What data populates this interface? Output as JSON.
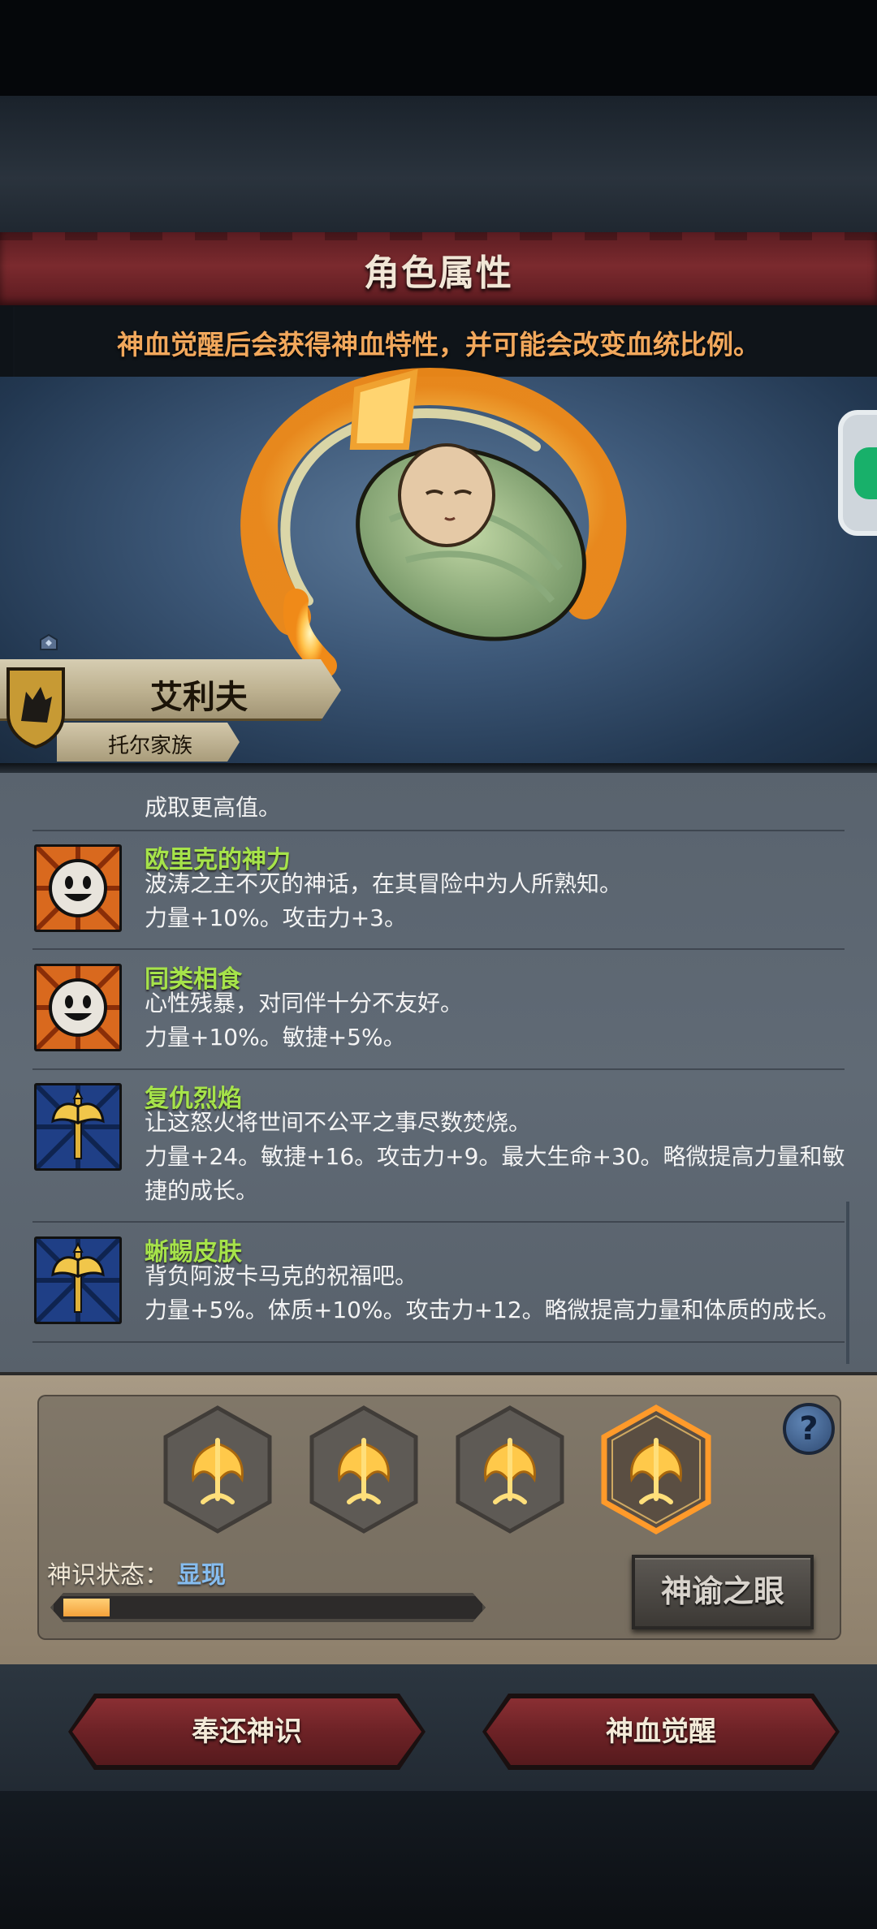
{
  "header": {
    "title": "角色属性",
    "hint": "神血觉醒后会获得神血特性，并可能会改变血统比例。"
  },
  "character": {
    "name": "艾利夫",
    "family": "托尔家族"
  },
  "traits": {
    "cut_off_text": "成取更高值。",
    "items": [
      {
        "name": "欧里克的神力",
        "desc": "波涛之主不灭的神话，在其冒险中为人所熟知。",
        "effect": "力量+10%。攻击力+3。",
        "effect2": "",
        "icon": "smiley-face-icon"
      },
      {
        "name": "同类相食",
        "desc": "心性残暴，对同伴十分不友好。",
        "effect": "力量+10%。敏捷+5%。",
        "effect2": "",
        "icon": "smiley-face-icon"
      },
      {
        "name": "复仇烈焰",
        "desc": "让这怒火将世间不公平之事尽数焚烧。",
        "effect": "力量+24。敏捷+16。攻击力+9。最大生命+30。略微提高力量和敏",
        "effect2": "捷的成长。",
        "icon": "axe-icon"
      },
      {
        "name": "蜥蜴皮肤",
        "desc": "背负阿波卡马克的祝福吧。",
        "effect": "力量+5%。体质+10%。攻击力+12。略微提高力量和体质的成长。",
        "effect2": "",
        "icon": "axe-icon"
      }
    ]
  },
  "runes": {
    "count": 4,
    "selected_index": 3,
    "icon": "trident-rune-icon",
    "help_label": "?"
  },
  "status": {
    "label": "神识状态：",
    "value": "显现",
    "progress": 0.08
  },
  "buttons": {
    "oracle": "神谕之眼",
    "return": "奉还神识",
    "awaken": "神血觉醒"
  },
  "colors": {
    "trait_name": "#a6e34a",
    "hint": "#f2a85c",
    "status_value": "#86bdf0",
    "progress_fill": "#f3a13a",
    "selected_rune_glow": "#ff9a2a"
  }
}
